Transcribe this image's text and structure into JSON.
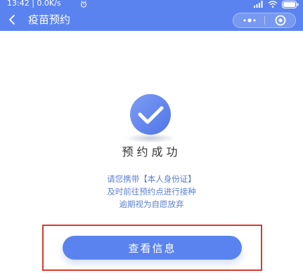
{
  "status_bar": {
    "time": "13:42 | 0.0K/s",
    "icons": [
      "alarm-icon",
      "signal-icon",
      "wifi-icon",
      "battery-icon"
    ]
  },
  "nav": {
    "title": "疫苗预约",
    "back_icon": "chevron-left-icon",
    "more_icon": "more-dots-icon",
    "close_icon": "target-icon"
  },
  "result": {
    "icon": "check-circle-icon",
    "title": "预约成功",
    "notice_lines": [
      "请您携带【本人身份证】",
      "及时前往预约点进行接种",
      "逾期视为自愿放弃"
    ]
  },
  "action": {
    "button_label": "查看信息"
  },
  "colors": {
    "primary": "#5a83ef",
    "highlight_border": "#d83a2e",
    "notice_text": "#5b7fd0"
  }
}
